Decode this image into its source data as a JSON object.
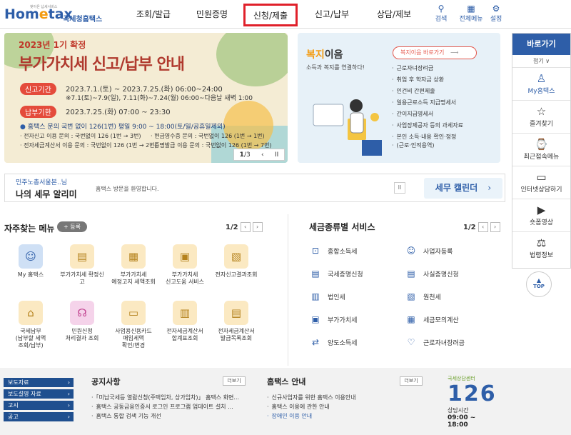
{
  "header": {
    "logo": {
      "brand_a": "Hom",
      "brand_b": "e",
      "brand_c": "tax",
      "agency": "국세청홈택스",
      "slogan": "찾아온 납세서비스"
    },
    "nav": [
      "조회/발급",
      "민원증명",
      "신청/제출",
      "신고/납부",
      "상담/제보"
    ],
    "tools": [
      {
        "label": "검색",
        "icon": "search-icon"
      },
      {
        "label": "전체메뉴",
        "icon": "grid-icon"
      },
      {
        "label": "설정",
        "icon": "gear-icon"
      }
    ]
  },
  "banner": {
    "kicker": "2023년 1기 확정",
    "headline": "부가가치세 신고/납부 안내",
    "period_pill": "신고기간",
    "period_line1": "2023.7.1.(토) ~ 2023.7.25.(화) 06:00~24:00",
    "period_line2": "※7.1(토)~7.9(일), 7.11(화)~7.24(월) 06:00~다음날 새벽 1:00",
    "due_pill": "납부기한",
    "due_line": "2023.7.25.(화) 07:00 ~ 23:30",
    "help_line": "홈택스 문의 국번 없이 126(1번) 평일 9:00 ~ 18:00(토/일/공휴일제외)",
    "small": [
      "· 전자신고 이용 문의 : 국번없이 126 (1번 → 3번)",
      "· 현금영수증 문의 : 국번없이 126 (1번 → 1번)",
      "· 전자세금계산서 이용 문의 : 국번없이 126 (1번 → 2번)",
      "· 증명발급 이용 문의 : 국번없이 126 (1번 → 7번)"
    ],
    "pager": {
      "current": "1",
      "total": "/3"
    }
  },
  "welfare": {
    "title_a": "복지",
    "title_b": "이음",
    "subtitle": "소득과 복지를 연결하다!",
    "button": "복지이음 바로가기",
    "items": [
      "근로자녀장려금",
      "취업 후 학자금 상환",
      "인건비 간편제출",
      "일용근로소득 지급명세서",
      "간이지급명세서",
      "사업장제공자 등의 과세자료",
      "본인 소득·내용 확인·정정",
      "(근로·인적용역)"
    ]
  },
  "notice": {
    "office": "민주노총서울본..님",
    "name": "나의 세무 알리미",
    "welcome": "홈택스 방문을 환영합니다.",
    "pause": "II",
    "calendar": "세무 캘린더"
  },
  "quick": {
    "title": "자주찾는 메뉴",
    "register": "+ 등록",
    "page": "1/2",
    "items": [
      {
        "label1": "My 홈택스",
        "label2": "",
        "label3": "",
        "icon": "user-icon",
        "bg": "#cfe0f5"
      },
      {
        "label1": "부가가치세 확정신",
        "label2": "고",
        "label3": "",
        "icon": "document-icon",
        "bg": "#fbe9c2"
      },
      {
        "label1": "부가가치세",
        "label2": "예정고지 세액조회",
        "label3": "",
        "icon": "calculator-icon",
        "bg": "#fbe9c2"
      },
      {
        "label1": "부가가치세",
        "label2": "신고도움 서비스",
        "label3": "",
        "icon": "report-icon",
        "bg": "#fbe9c2"
      },
      {
        "label1": "전자신고결과조회",
        "label2": "",
        "label3": "",
        "icon": "search-doc-icon",
        "bg": "#fbe9c2"
      },
      {
        "label1": "국세납부",
        "label2": "(납부할 세액",
        "label3": "조회/납부)",
        "icon": "bank-icon",
        "bg": "#fbe9c2"
      },
      {
        "label1": "민원신청",
        "label2": "처리결과 조회",
        "label3": "",
        "icon": "headset-icon",
        "bg": "#f5d3ea"
      },
      {
        "label1": "사업용신용카드",
        "label2": "매입세액",
        "label3": "확인/변경",
        "icon": "card-icon",
        "bg": "#fbe9c2"
      },
      {
        "label1": "전자세금계산서",
        "label2": "합계표조회",
        "label3": "",
        "icon": "invoice-icon",
        "bg": "#fbe9c2"
      },
      {
        "label1": "전자세금계산서",
        "label2": "발급목록조회",
        "label3": "",
        "icon": "list-doc-icon",
        "bg": "#fbe9c2"
      }
    ]
  },
  "taxes": {
    "title": "세금종류별 서비스",
    "page": "1/2",
    "items": [
      {
        "label": "종합소득세",
        "icon": "wallet-icon"
      },
      {
        "label": "사업자등록",
        "icon": "user-icon"
      },
      {
        "label": "국세증명신청",
        "icon": "certificate-icon"
      },
      {
        "label": "사실증명신청",
        "icon": "document-icon"
      },
      {
        "label": "법인세",
        "icon": "building-icon"
      },
      {
        "label": "원천세",
        "icon": "receipt-icon"
      },
      {
        "label": "부가가치세",
        "icon": "vat-icon"
      },
      {
        "label": "세금모의계산",
        "icon": "calculator-icon"
      },
      {
        "label": "양도소득세",
        "icon": "transfer-icon"
      },
      {
        "label": "근로자녀장려금",
        "icon": "heart-icon"
      }
    ]
  },
  "sidebar": {
    "title": "바로가기",
    "fold": "접기 ∨",
    "items": [
      {
        "label": "My홈택스",
        "icon": "user-icon"
      },
      {
        "label": "즐겨찾기",
        "icon": "star-icon"
      },
      {
        "label": "최근접속메뉴",
        "icon": "history-icon"
      },
      {
        "label": "인터넷상담하기",
        "icon": "monitor-icon"
      },
      {
        "label": "숏폼영상",
        "icon": "play-icon"
      },
      {
        "label": "법령정보",
        "icon": "gavel-icon"
      }
    ],
    "top": "TOP"
  },
  "footer": {
    "links": [
      "보도자료",
      "보도설명 자료",
      "고시",
      "공고"
    ],
    "notices_title": "공지사항",
    "notices_more": "더보기",
    "notices": [
      "「미납국세등 열람신청(주택임차, 상가임차)」 홈택스 화면...",
      "홈택스 공동금융인증서 로그인 프로그램 업데이트 설치 ...",
      "홈택스 통합 검색 기능 개선"
    ],
    "guide_title": "홈택스 안내",
    "guide_more": "더보기",
    "guide": [
      "신규사업자를 위한 홈택스 이용안내",
      "홈택스 이용에 관한 안내",
      "장애인 이용 안내"
    ],
    "call": {
      "center": "국세상담센터",
      "number": "126",
      "label": "상담시간",
      "hours": "09:00 ~ 18:00"
    }
  }
}
